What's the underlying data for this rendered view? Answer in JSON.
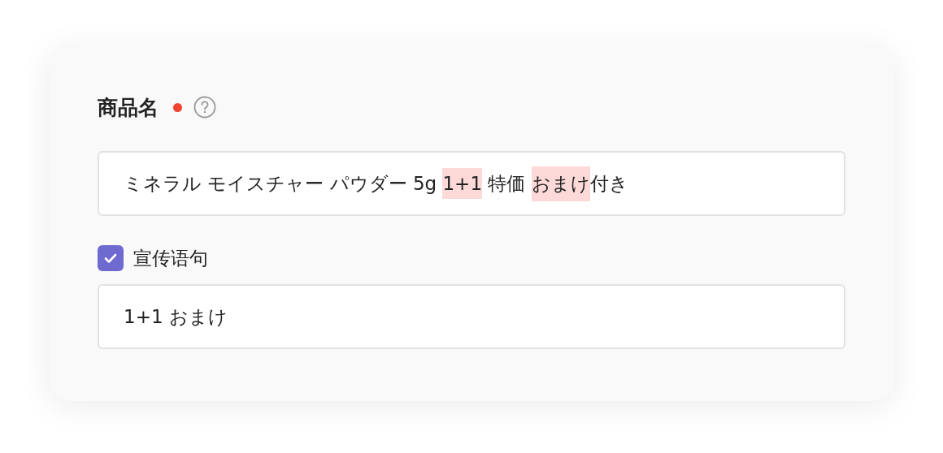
{
  "field_label": {
    "text": "商品名",
    "required": true
  },
  "product_name": {
    "segments": [
      {
        "text": "ミネラル モイスチャー パウダー 5g ",
        "highlighted": false
      },
      {
        "text": "1+1",
        "highlighted": true
      },
      {
        "text": " 特価 ",
        "highlighted": false
      },
      {
        "text": "おまけ",
        "highlighted": true
      },
      {
        "text": "付き",
        "highlighted": false
      }
    ]
  },
  "tagline": {
    "label": "宣传语句",
    "checked": true,
    "value": "1+1 おまけ"
  }
}
